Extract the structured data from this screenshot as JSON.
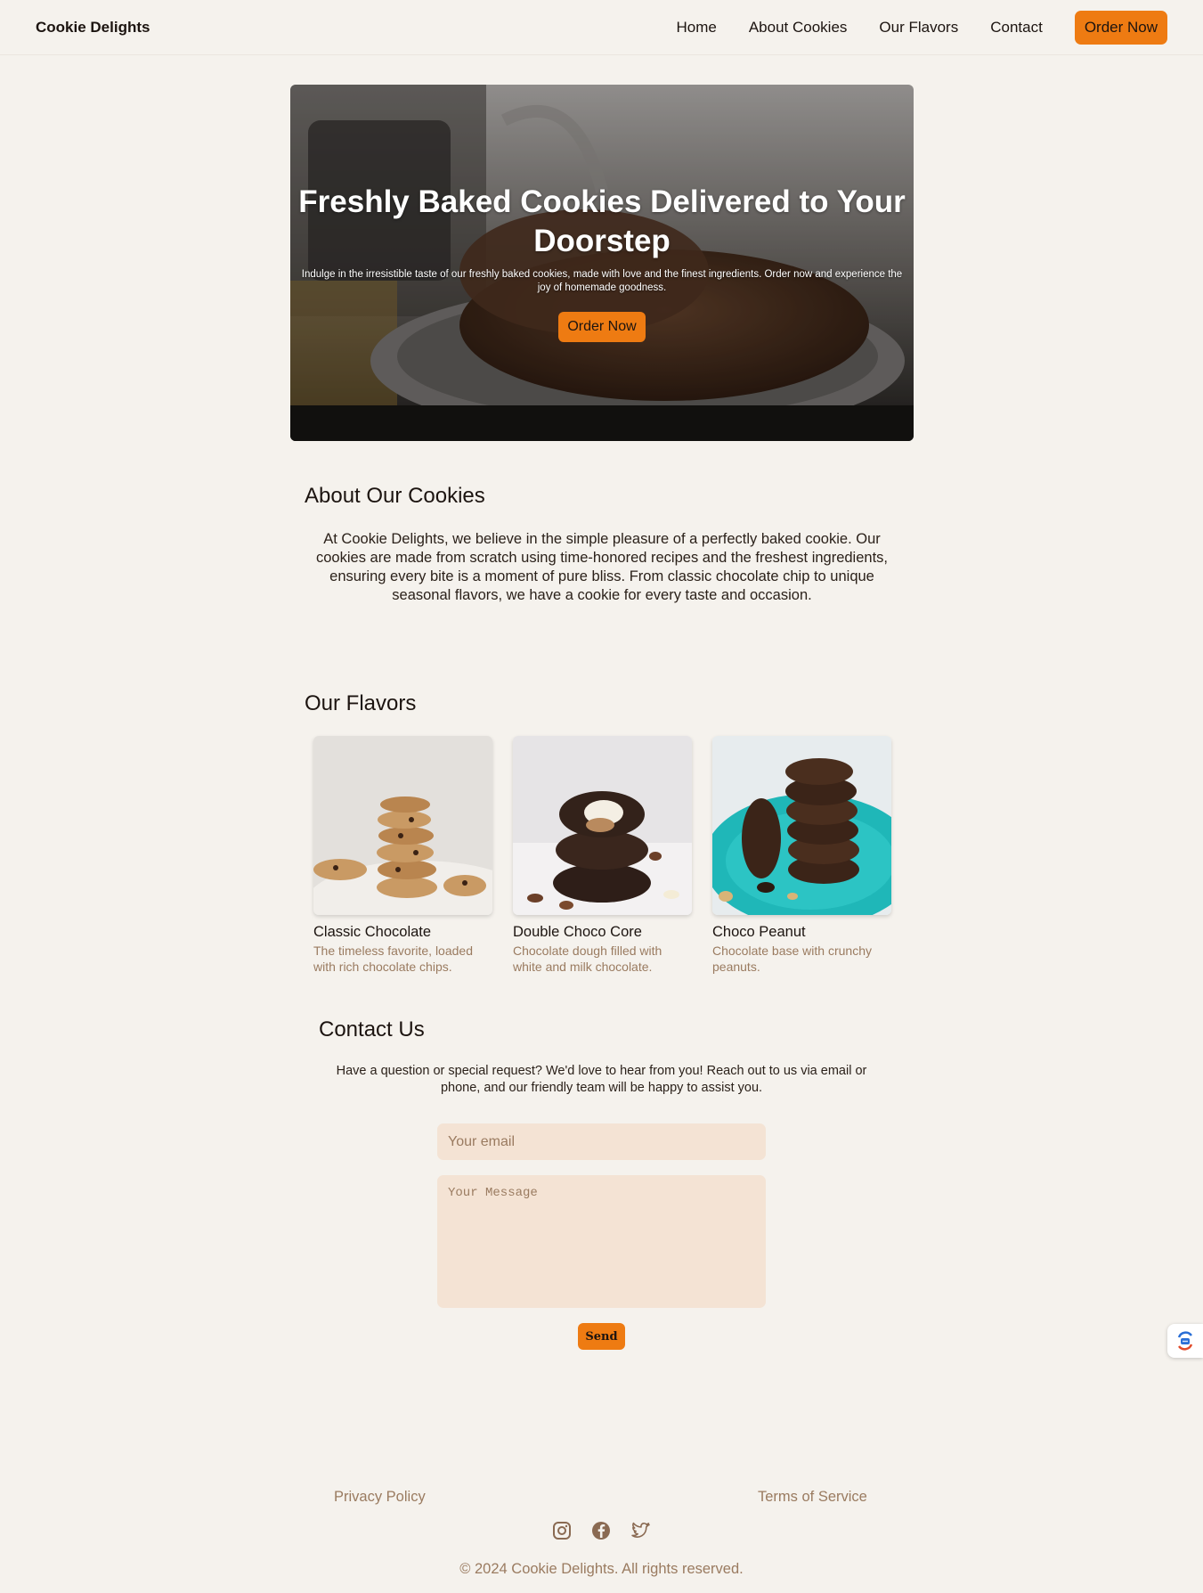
{
  "header": {
    "brand": "Cookie Delights",
    "nav": [
      "Home",
      "About Cookies",
      "Our Flavors",
      "Contact"
    ],
    "cta": "Order Now"
  },
  "hero": {
    "title": "Freshly Baked Cookies Delivered to Your Doorstep",
    "subtitle": "Indulge in the irresistible taste of our freshly baked cookies, made with love and the finest ingredients. Order now and experience the joy of homemade goodness.",
    "cta": "Order Now"
  },
  "about": {
    "heading": "About Our Cookies",
    "text": "At Cookie Delights, we believe in the simple pleasure of a perfectly baked cookie. Our cookies are made from scratch using time-honored recipes and the freshest ingredients, ensuring every bite is a moment of pure bliss. From classic chocolate chip to unique seasonal flavors, we have a cookie for every taste and occasion."
  },
  "flavors": {
    "heading": "Our Flavors",
    "items": [
      {
        "name": "Classic Chocolate",
        "desc": "The timeless favorite, loaded with rich chocolate chips."
      },
      {
        "name": "Double Choco Core",
        "desc": "Chocolate dough filled with white and milk chocolate."
      },
      {
        "name": "Choco Peanut",
        "desc": "Chocolate base with crunchy peanuts."
      }
    ]
  },
  "contact": {
    "heading": "Contact Us",
    "text": "Have a question or special request? We'd love to hear from you! Reach out to us via email or phone, and our friendly team will be happy to assist you.",
    "email_placeholder": "Your email",
    "message_placeholder": "Your Message",
    "send": "Send"
  },
  "footer": {
    "privacy": "Privacy Policy",
    "terms": "Terms of Service",
    "socials": [
      "instagram-icon",
      "facebook-icon",
      "twitter-icon"
    ],
    "copyright": "© 2024 Cookie Delights. All rights reserved."
  },
  "colors": {
    "background": "#f5f2ed",
    "accent": "#ee7b12",
    "muted": "#9a7b60",
    "input_bg": "#f4e3d4"
  }
}
